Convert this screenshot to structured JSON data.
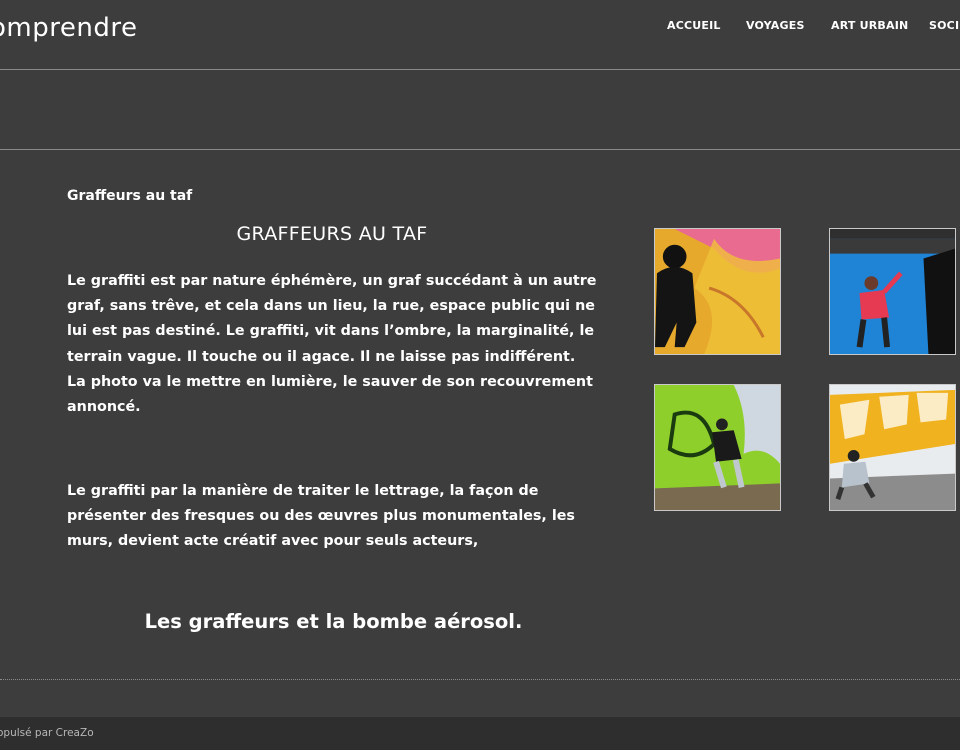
{
  "header": {
    "site_title": "omprendre",
    "nav": [
      "ACCUEIL",
      "VOYAGES",
      "ART URBAIN",
      "SOCIÉ"
    ]
  },
  "main": {
    "breadcrumb": "Graffeurs au taf",
    "title": "GRAFFEURS AU TAF",
    "paragraphs": [
      "Le graffiti est par nature éphémère, un graf succédant à un autre graf, sans trêve, et cela dans un lieu, la rue, espace public qui ne lui est pas destiné. Le graffiti, vit dans l’ombre, la marginalité, le terrain vague. Il touche ou il agace. Il ne laisse pas indifférent. La photo va le mettre en lumière, le sauver de son recouvrement annoncé.",
      "Le graffiti par la manière de traiter le lettrage, la façon de présenter des fresques ou des œuvres plus monumentales, les murs, devient acte créatif avec pour seuls acteurs,"
    ],
    "quote": "Les graffeurs et la bombe aérosol."
  },
  "gallery": {
    "thumbnails": [
      "graffeur-mur-jaune",
      "graffeuse-mur-bleu",
      "graffeur-mur-vert",
      "graffeur-accroupi"
    ]
  },
  "footer": {
    "credit": "opulsé par CreaZo"
  },
  "colors": {
    "background": "#3d3d3d",
    "footer": "#2e2e2e",
    "text": "#ffffff"
  }
}
